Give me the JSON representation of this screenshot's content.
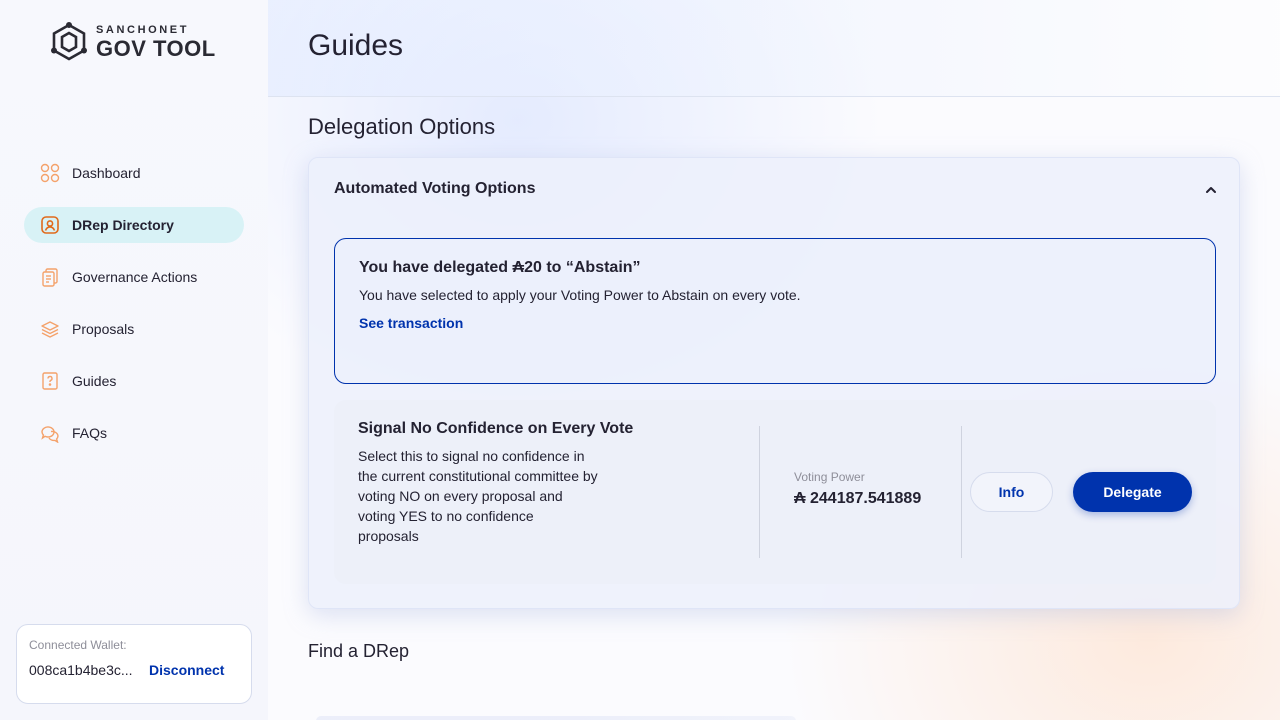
{
  "sidebar": {
    "logo": {
      "top": "SANCHONET",
      "bottom": "GOV TOOL"
    },
    "items": [
      {
        "label": "Dashboard",
        "icon": "dashboard-icon",
        "active": false
      },
      {
        "label": "DRep Directory",
        "icon": "drep-directory-icon",
        "active": true
      },
      {
        "label": "Governance Actions",
        "icon": "governance-actions-icon",
        "active": false
      },
      {
        "label": "Proposals",
        "icon": "proposals-icon",
        "active": false
      },
      {
        "label": "Guides",
        "icon": "guides-icon",
        "active": false
      },
      {
        "label": "FAQs",
        "icon": "faqs-icon",
        "active": false
      }
    ],
    "wallet": {
      "label": "Connected Wallet:",
      "address": "008ca1b4be3c...",
      "disconnect": "Disconnect"
    }
  },
  "header": {
    "title": "Guides"
  },
  "delegation": {
    "section_title": "Delegation Options",
    "accordion_title": "Automated Voting Options",
    "delegated": {
      "title": "You have delegated ₳20 to “Abstain”",
      "description": "You have selected to apply your Voting Power to Abstain on every vote.",
      "link": "See transaction"
    },
    "option": {
      "title": "Signal No Confidence on Every Vote",
      "description": "Select this to signal no confidence in the current constitutional committee by voting NO on every proposal and voting YES to no confidence proposals",
      "voting_power_label": "Voting Power",
      "voting_power_value": "₳ 244187.541889",
      "info_label": "Info",
      "delegate_label": "Delegate"
    }
  },
  "find_drep": {
    "title": "Find a DRep"
  },
  "colors": {
    "accent": "#0033ad",
    "active_nav": "#d8f2f6",
    "icon": "#f4a26b"
  }
}
